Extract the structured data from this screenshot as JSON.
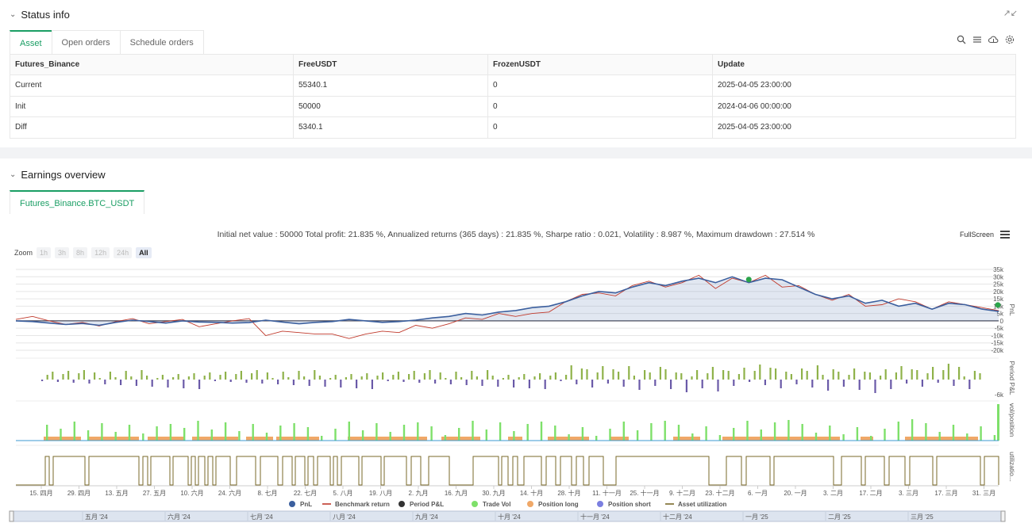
{
  "status": {
    "title": "Status info",
    "tabs": [
      "Asset",
      "Open orders",
      "Schedule orders"
    ],
    "table": {
      "headers": [
        "Futures_Binance",
        "FreeUSDT",
        "FrozenUSDT",
        "Update"
      ],
      "rows": [
        [
          "Current",
          "55340.1",
          "0",
          "2025-04-05 23:00:00"
        ],
        [
          "Init",
          "50000",
          "0",
          "2024-04-06 00:00:00"
        ],
        [
          "Diff",
          "5340.1",
          "0",
          "2025-04-05 23:00:00"
        ]
      ]
    },
    "tool_icons": [
      "search-icon",
      "list-icon",
      "cloud-icon",
      "gear-icon"
    ]
  },
  "earnings": {
    "title": "Earnings overview",
    "tab": "Futures_Binance.BTC_USDT",
    "summary": "Initial net value : 50000 Total profit: 21.835 %, Annualized returns (365 days) : 21.835 %, Sharpe ratio : 0.021, Volatility : 8.987 %, Maximum drawdown : 27.514 %",
    "fullscreen_label": "FullScreen",
    "zoom_label": "Zoom",
    "zoom_options": [
      "1h",
      "3h",
      "8h",
      "12h",
      "24h",
      "All"
    ],
    "zoom_selected": "All"
  },
  "chart_data": {
    "type": "line",
    "x_ticks": [
      "15. 四月",
      "29. 四月",
      "13. 五月",
      "27. 五月",
      "10. 六月",
      "24. 六月",
      "8. 七月",
      "22. 七月",
      "5. 八月",
      "19. 八月",
      "2. 九月",
      "16. 九月",
      "30. 九月",
      "14. 十月",
      "28. 十月",
      "11. 十一月",
      "25. 十一月",
      "9. 十二月",
      "23. 十二月",
      "6. 一月",
      "20. 一月",
      "3. 二月",
      "17. 二月",
      "3. 三月",
      "17. 三月",
      "31. 三月"
    ],
    "navigator_ticks": [
      "五月 '24",
      "六月 '24",
      "七月 '24",
      "八月 '24",
      "九月 '24",
      "十月 '24",
      "十一月 '24",
      "十二月 '24",
      "一月 '25",
      "二月 '25",
      "三月 '25"
    ],
    "pnl_axis": {
      "ticks": [
        "35k",
        "30k",
        "25k",
        "20k",
        "15k",
        "10k",
        "5k",
        "0",
        "-5k",
        "-10k",
        "-15k",
        "-20k"
      ],
      "range": [
        -20000,
        35000
      ],
      "label": "PnL"
    },
    "period_axis": {
      "ticks": [
        "-6k"
      ],
      "label": "Period P&L"
    },
    "vol_axis_label": "vol/position",
    "util_axis_label": "utilizatio...",
    "legend": [
      {
        "name": "PnL",
        "color": "#3b5f9e",
        "marker": "dot"
      },
      {
        "name": "Benchmark return",
        "color": "#c0392b",
        "marker": "line"
      },
      {
        "name": "Period P&L",
        "color": "#333333",
        "marker": "dot"
      },
      {
        "name": "Trade Vol",
        "color": "#7ee06a",
        "marker": "dot"
      },
      {
        "name": "Position long",
        "color": "#f0a868",
        "marker": "dot"
      },
      {
        "name": "Position short",
        "color": "#7b7fe0",
        "marker": "dot"
      },
      {
        "name": "Asset utilization",
        "color": "#7a6a2a",
        "marker": "line"
      }
    ],
    "pnl": [
      0,
      -500,
      -1500,
      -2500,
      -1800,
      -3000,
      -1000,
      500,
      -500,
      -1500,
      0,
      -800,
      -1000,
      -1500,
      -1200,
      500,
      -800,
      -2000,
      -1000,
      -500,
      1000,
      0,
      -1000,
      -500,
      500,
      2000,
      3000,
      5000,
      4000,
      6000,
      7000,
      9000,
      10000,
      13000,
      17000,
      20000,
      19000,
      23000,
      26000,
      24000,
      27000,
      29000,
      26000,
      30000,
      26000,
      29000,
      28000,
      23000,
      18000,
      15000,
      17000,
      12000,
      14000,
      10000,
      12000,
      8000,
      12000,
      11000,
      8000,
      6500
    ],
    "benchmark": [
      1000,
      3000,
      0,
      -2500,
      -1000,
      -3500,
      -500,
      1500,
      -2000,
      -500,
      1000,
      -4000,
      -2000,
      0,
      1500,
      -10000,
      -7000,
      -8000,
      -9000,
      -9000,
      -12000,
      -9000,
      -7000,
      -8000,
      -3000,
      -5000,
      -2000,
      2000,
      1000,
      5000,
      3000,
      5000,
      6000,
      13000,
      18000,
      19000,
      17000,
      24000,
      27000,
      23000,
      26000,
      31000,
      22000,
      29000,
      26000,
      31000,
      23000,
      24000,
      18000,
      14000,
      18000,
      10000,
      11000,
      15000,
      13000,
      8000,
      13000,
      11000,
      9000,
      7000
    ],
    "asset_utilization_segments": [
      [
        57,
        62
      ],
      [
        67,
        107
      ],
      [
        112,
        175
      ],
      [
        180,
        186
      ],
      [
        190,
        214
      ],
      [
        218,
        237
      ],
      [
        241,
        246
      ],
      [
        250,
        258
      ],
      [
        262,
        268
      ],
      [
        272,
        290
      ],
      [
        298,
        322
      ],
      [
        328,
        350
      ],
      [
        356,
        368
      ],
      [
        372,
        384
      ],
      [
        388,
        395
      ],
      [
        400,
        416
      ],
      [
        420,
        425
      ],
      [
        430,
        452
      ],
      [
        456,
        480
      ],
      [
        484,
        512
      ],
      [
        518,
        530
      ],
      [
        540,
        566
      ],
      [
        596,
        628
      ],
      [
        632,
        640
      ],
      [
        646,
        652
      ],
      [
        660,
        682
      ],
      [
        688,
        700
      ],
      [
        706,
        720
      ],
      [
        726,
        735
      ],
      [
        742,
        760
      ],
      [
        776,
        893
      ],
      [
        915,
        934
      ],
      [
        940,
        970
      ],
      [
        975,
        1050
      ],
      [
        1060,
        1085
      ],
      [
        1090,
        1114
      ],
      [
        1120,
        1140
      ],
      [
        1146,
        1175
      ],
      [
        1180,
        1235
      ],
      [
        1240,
        1258
      ]
    ]
  }
}
